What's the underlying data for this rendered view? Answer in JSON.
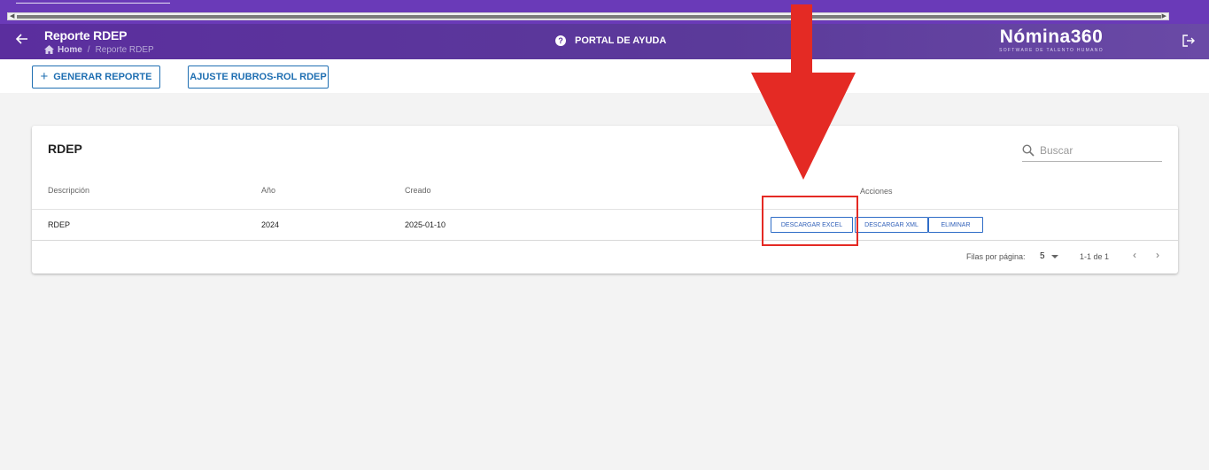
{
  "header": {
    "page_title": "Reporte RDEP",
    "breadcrumb_home": "Home",
    "breadcrumb_sep": "/",
    "breadcrumb_current": "Reporte RDEP",
    "help_label": "PORTAL DE AYUDA",
    "brand_name": "Nómina360",
    "brand_tagline": "SOFTWARE DE TALENTO HUMANO"
  },
  "toolbar": {
    "generar_label": "GENERAR REPORTE",
    "ajuste_label": "AJUSTE RUBROS-ROL RDEP"
  },
  "card": {
    "title": "RDEP",
    "search_placeholder": "Buscar",
    "columns": [
      "Descripción",
      "Año",
      "Creado",
      "Acciones"
    ],
    "rows": [
      {
        "descripcion": "RDEP",
        "anio": "2024",
        "creado": "2025-01-10"
      }
    ],
    "actions": {
      "excel_label": "DESCARGAR EXCEL",
      "xml_label": "DESCARGAR XML",
      "delete_label": "ELIMINAR"
    },
    "pagination": {
      "rows_per_page_label": "Filas por página:",
      "rows_per_page_value": "5",
      "range_text": "1-1 de 1"
    }
  },
  "colors": {
    "header_purple": "#5b2e9e",
    "accent_blue": "#1f6fb2",
    "annotation_red": "#e42a24"
  }
}
